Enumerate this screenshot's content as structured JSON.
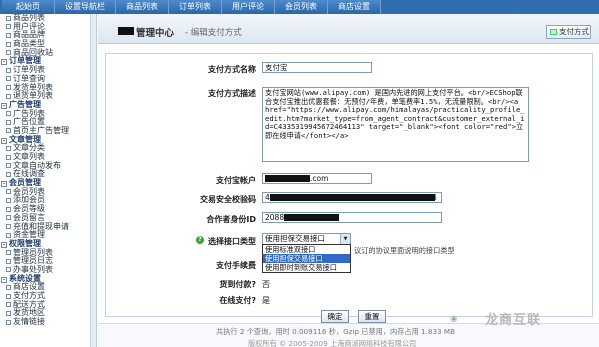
{
  "topnav": {
    "tabs": [
      "起始页",
      "设置导航栏",
      "商品列表",
      "订单列表",
      "用户评论",
      "会员列表",
      "商店设置"
    ]
  },
  "sidebar": {
    "entries": [
      {
        "type": "item",
        "label": "商品列表"
      },
      {
        "type": "item",
        "label": "用户评论"
      },
      {
        "type": "item",
        "label": "商品品牌"
      },
      {
        "type": "item",
        "label": "商品类型"
      },
      {
        "type": "item",
        "label": "商品回收站"
      },
      {
        "type": "group",
        "label": "订单管理"
      },
      {
        "type": "item",
        "label": "订单列表"
      },
      {
        "type": "item",
        "label": "订单查询"
      },
      {
        "type": "item",
        "label": "发货单列表"
      },
      {
        "type": "item",
        "label": "退货单列表"
      },
      {
        "type": "group",
        "label": "广告管理"
      },
      {
        "type": "item",
        "label": "广告列表"
      },
      {
        "type": "item",
        "label": "广告位置"
      },
      {
        "type": "item",
        "label": "首页主广告管理"
      },
      {
        "type": "group",
        "label": "文章管理"
      },
      {
        "type": "item",
        "label": "文章分类"
      },
      {
        "type": "item",
        "label": "文章列表"
      },
      {
        "type": "item",
        "label": "文章自动发布"
      },
      {
        "type": "item",
        "label": "在线调查"
      },
      {
        "type": "group",
        "label": "会员管理"
      },
      {
        "type": "item",
        "label": "会员列表"
      },
      {
        "type": "item",
        "label": "添加会员"
      },
      {
        "type": "item",
        "label": "会员等级"
      },
      {
        "type": "item",
        "label": "会员留言"
      },
      {
        "type": "item",
        "label": "充值和提现申请"
      },
      {
        "type": "item",
        "label": "资金管理"
      },
      {
        "type": "group",
        "label": "权限管理"
      },
      {
        "type": "item",
        "label": "管理员列表"
      },
      {
        "type": "item",
        "label": "管理员日志"
      },
      {
        "type": "item",
        "label": "办事处列表"
      },
      {
        "type": "group",
        "label": "系统设置"
      },
      {
        "type": "item",
        "label": "商店设置"
      },
      {
        "type": "item",
        "label": "支付方式"
      },
      {
        "type": "item",
        "label": "配送方式"
      },
      {
        "type": "item",
        "label": "发货地区"
      },
      {
        "type": "item",
        "label": "友情链接"
      }
    ]
  },
  "header": {
    "title": "管理中心",
    "subtitle": "- 编辑支付方式",
    "payment_list_button": "支付方式"
  },
  "form": {
    "name_label": "支付方式名称",
    "name_value": "支付宝",
    "desc_label": "支付方式描述",
    "desc_value": "支付宝网站(www.alipay.com) 是国内先进的网上支付平台。<br/>ECShop联合支付宝推出优惠套餐：无预付/年费，单笔费率1.5%，无流量限制。<br/><a href=\"https://www.alipay.com/himalayas/practicality_profile_edit.htm?market_type=from_agent_contract&customer_external_id=C4335319945672464113\" target=\"_blank\"><font color=\"red\">立即在线申请</font></a>",
    "account_label": "支付宝帐户",
    "account_value": ".com",
    "key_label": "交易安全校验码",
    "key_prefix": "4",
    "key_suffix": "i",
    "partner_label": "合作者身份ID",
    "partner_value": "2088",
    "interface_label": "选择接口类型",
    "interface_value": "使用担保交易接口",
    "interface_options": [
      "使用标准双接口",
      "使用担保交易接口",
      "使用即时到账交易接口"
    ],
    "interface_selected_index": 1,
    "interface_note": "议订的协议里面说明的接口类型",
    "fee_label": "支付手续费",
    "cod_label": "货到付款?",
    "cod_value": "否",
    "online_label": "在线支付?",
    "online_value": "是",
    "submit_button": "确定",
    "reset_button": "重置"
  },
  "footer": {
    "stats": "共执行 2 个查询，用时 0.009116 秒，Gzip 已禁用，内存占用 1.833 MB",
    "copyright": "版权所有 © 2005-2009 上海商派网络科技有限公司"
  },
  "watermark": {
    "brand": "龙商互联"
  }
}
